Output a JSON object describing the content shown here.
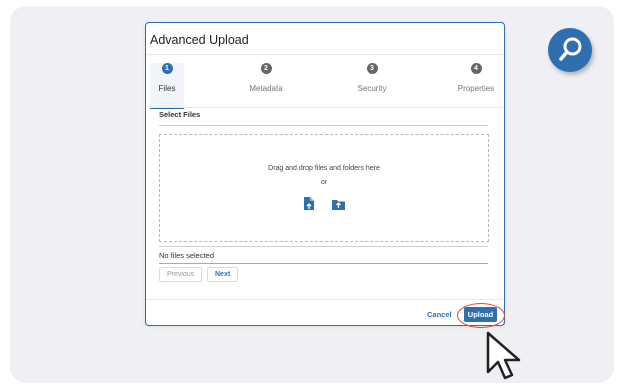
{
  "dialog": {
    "title": "Advanced Upload",
    "steps": [
      {
        "number": "1",
        "label": "Files",
        "active": true
      },
      {
        "number": "2",
        "label": "Metadata",
        "active": false
      },
      {
        "number": "3",
        "label": "Security",
        "active": false
      },
      {
        "number": "4",
        "label": "Properties",
        "active": false
      }
    ],
    "section_label": "Select Files",
    "dropzone": {
      "instruction": "Drag and drop files and folders here",
      "or_text": "or",
      "icons": [
        "file-upload-icon",
        "folder-upload-icon"
      ]
    },
    "file_status": "No files selected",
    "nav": {
      "previous_label": "Previous",
      "next_label": "Next"
    },
    "footer": {
      "cancel_label": "Cancel",
      "upload_label": "Upload"
    }
  },
  "overlay": {
    "search_icon": "search-icon",
    "pointer_icon": "cursor-pointer-icon"
  },
  "colors": {
    "accent": "#2f6fb0",
    "highlight": "#e04848",
    "background": "#eef0f3"
  }
}
